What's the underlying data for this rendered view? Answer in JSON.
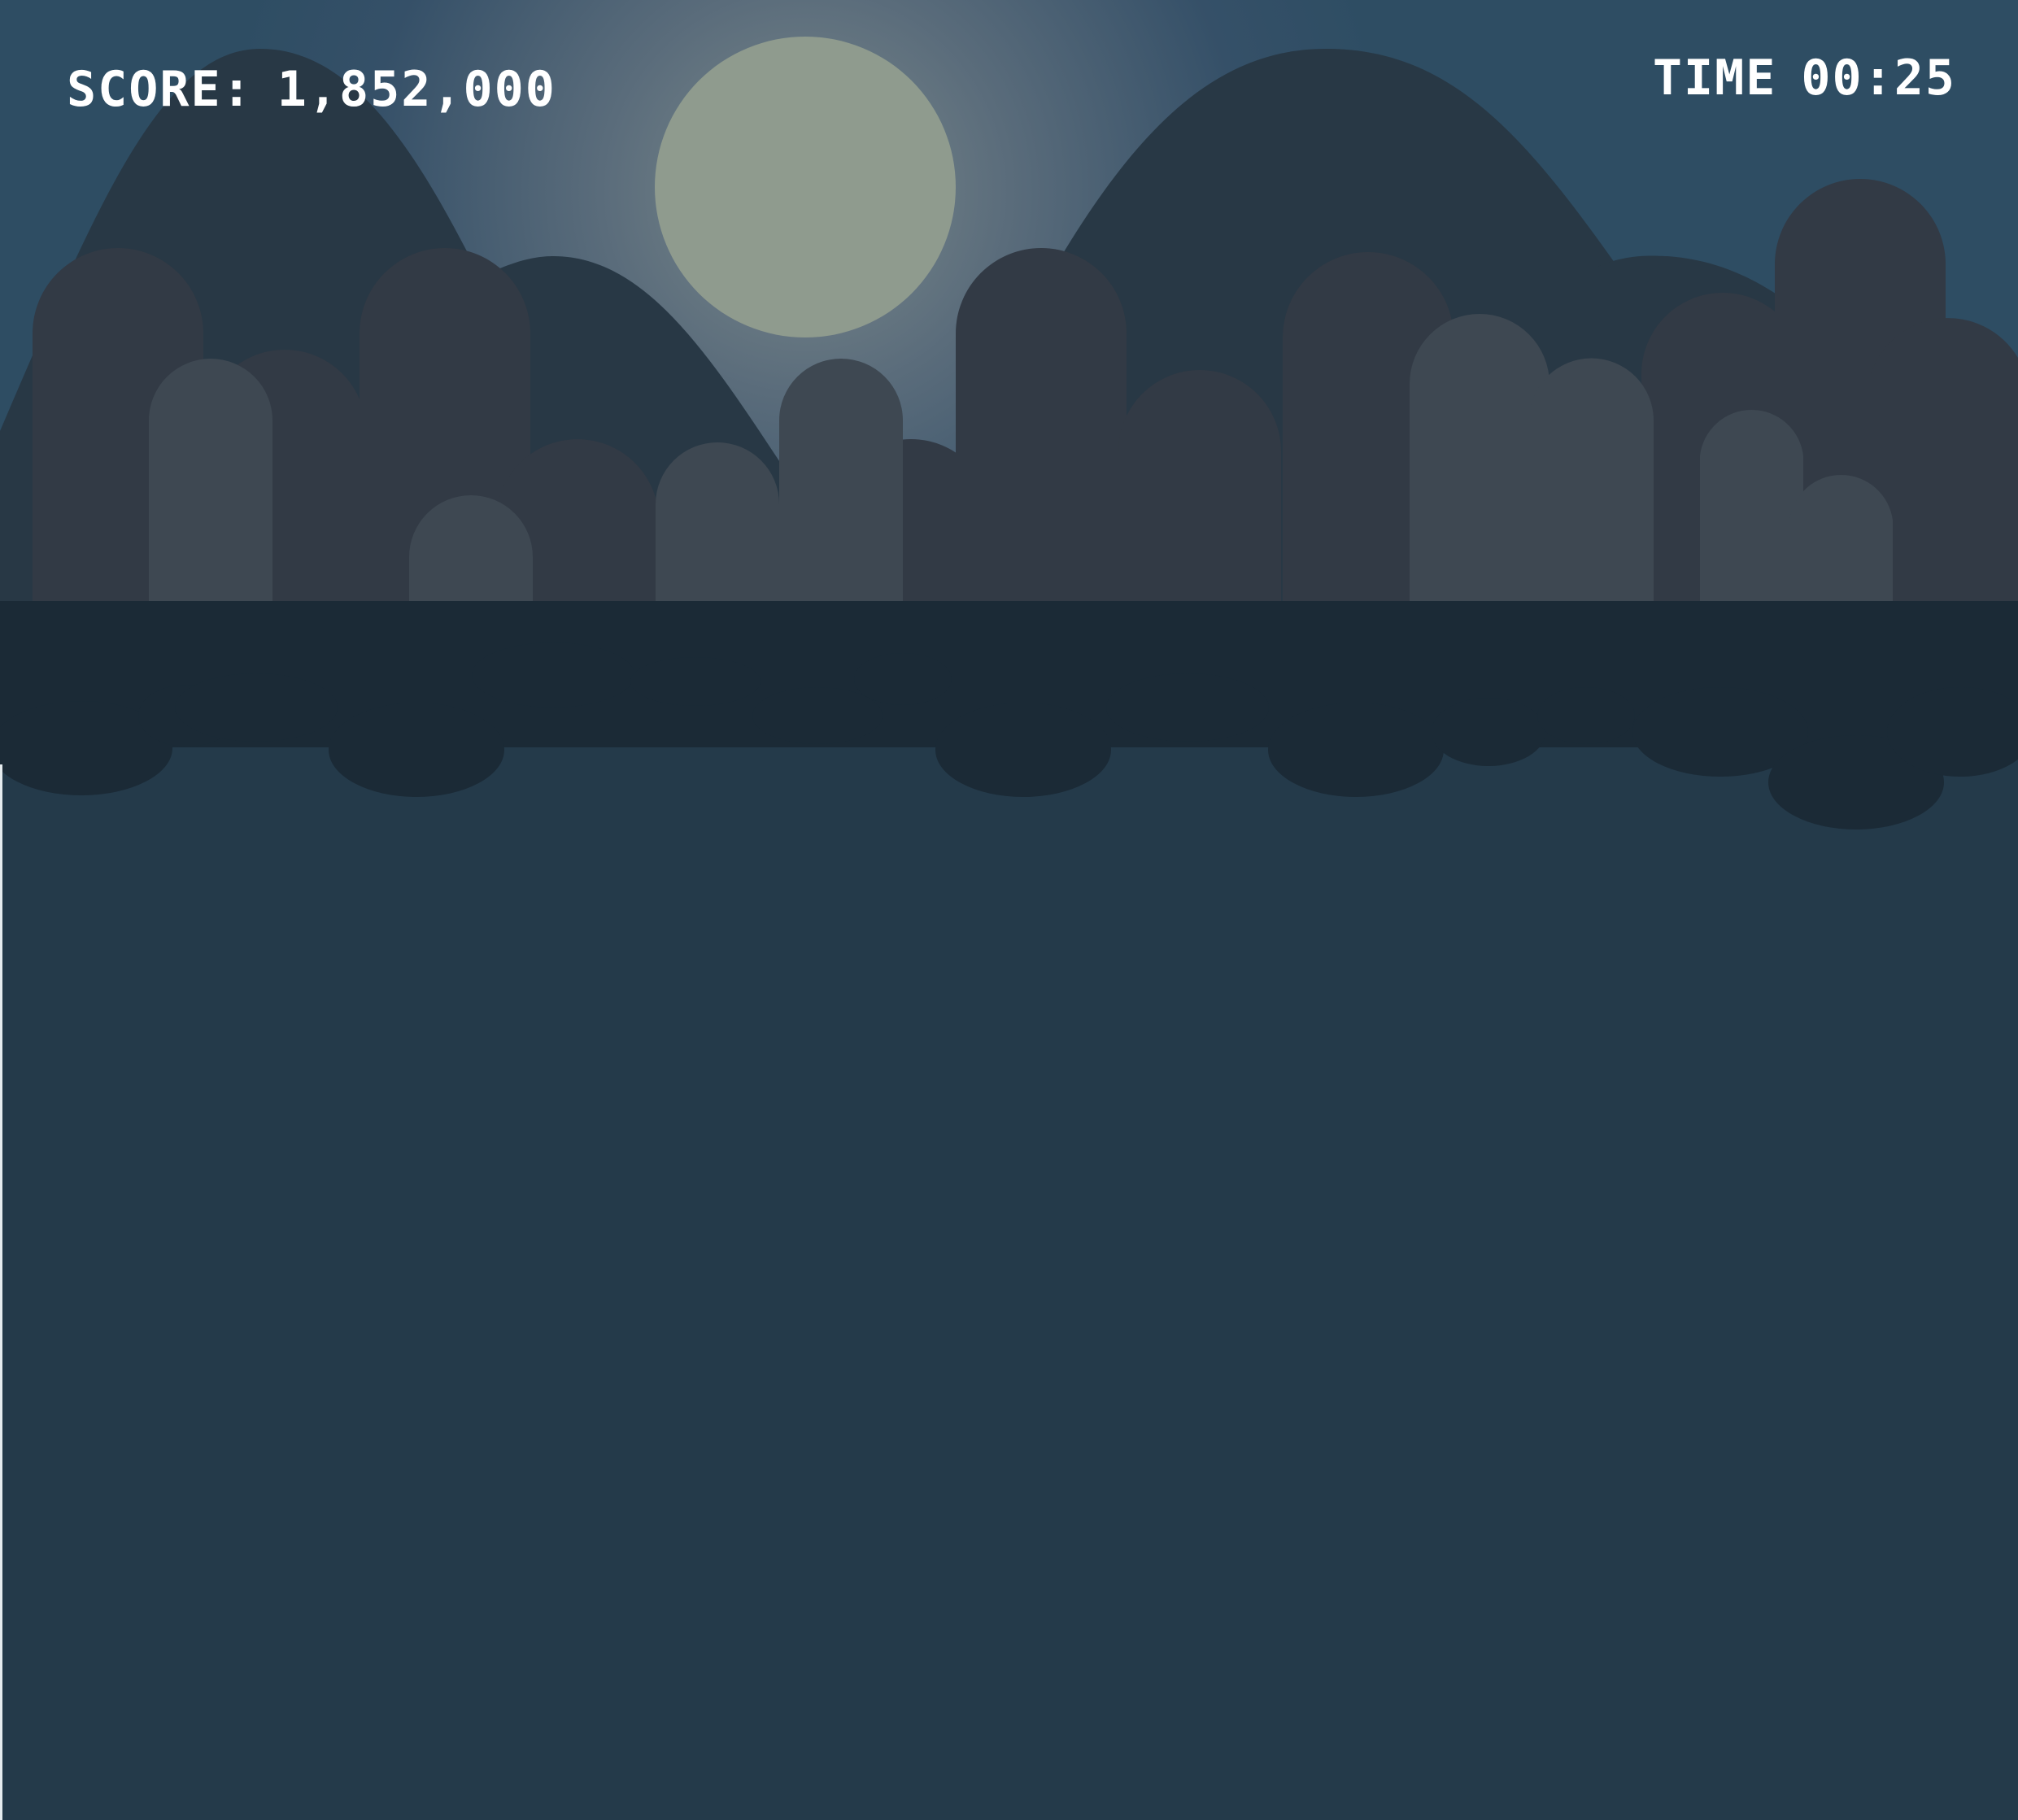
{
  "hud": {
    "score_label": "SCORE:",
    "score_value": "1,852,000",
    "time_label": "TIME",
    "time_value": "00:25"
  },
  "colors": {
    "sky": "#2e4d63",
    "moon": "#8f9b8e",
    "moon_glow": "#6d7f88",
    "mountains": "#283845",
    "back_buildings": "#323a45",
    "front_buildings": "#3e4852",
    "shore_shadow": "#1b2a36",
    "water": "#243a4a",
    "hud_text": "#ffffff"
  },
  "scene": {
    "moon-icon": "moon-icon",
    "mountain-icon": "mountain-icon",
    "building-icon": "building-icon"
  }
}
